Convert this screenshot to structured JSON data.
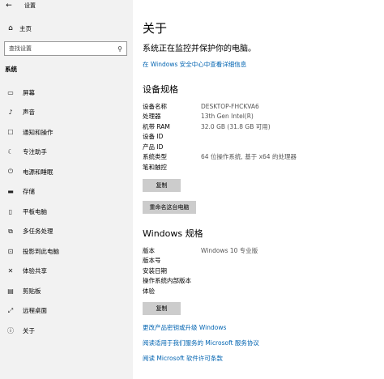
{
  "window": {
    "title": "设置",
    "back_glyph": "←"
  },
  "sidebar": {
    "home_label": "主页",
    "search_placeholder": "查找设置",
    "section": "系统",
    "items": [
      {
        "label": "屏幕",
        "icon": "monitor-icon"
      },
      {
        "label": "声音",
        "icon": "speaker-icon"
      },
      {
        "label": "通知和操作",
        "icon": "notification-icon"
      },
      {
        "label": "专注助手",
        "icon": "moon-icon"
      },
      {
        "label": "电源和睡眠",
        "icon": "power-icon"
      },
      {
        "label": "存储",
        "icon": "storage-icon"
      },
      {
        "label": "平板电脑",
        "icon": "tablet-icon"
      },
      {
        "label": "多任务处理",
        "icon": "multitask-icon"
      },
      {
        "label": "投影到此电脑",
        "icon": "project-icon"
      },
      {
        "label": "体验共享",
        "icon": "share-icon"
      },
      {
        "label": "剪贴板",
        "icon": "clipboard-icon"
      },
      {
        "label": "远程桌面",
        "icon": "remote-icon"
      },
      {
        "label": "关于",
        "icon": "info-icon"
      }
    ]
  },
  "main": {
    "title": "关于",
    "subtitle": "系统正在监控并保护你的电脑。",
    "security_link": "在 Windows 安全中心中查看详细信息",
    "device_specs": {
      "heading": "设备规格",
      "rows": [
        {
          "key": "设备名称",
          "value": "DESKTOP-FHCKVA6"
        },
        {
          "key": "处理器",
          "value": "13th Gen Intel(R)"
        },
        {
          "key": "机带 RAM",
          "value": "32.0 GB (31.8 GB 可用)"
        },
        {
          "key": "设备 ID",
          "value": ""
        },
        {
          "key": "产品 ID",
          "value": ""
        },
        {
          "key": "系统类型",
          "value": "64 位操作系统, 基于 x64 的处理器"
        },
        {
          "key": "笔和触控",
          "value": ""
        }
      ],
      "copy_button": "复制",
      "rename_button": "重命名这台电脑"
    },
    "windows_specs": {
      "heading": "Windows 规格",
      "rows": [
        {
          "key": "版本",
          "value": "Windows 10 专业版"
        },
        {
          "key": "版本号",
          "value": ""
        },
        {
          "key": "安装日期",
          "value": ""
        },
        {
          "key": "操作系统内部版本",
          "value": ""
        },
        {
          "key": "体验",
          "value": ""
        }
      ],
      "copy_button": "复制"
    },
    "links": [
      "更改产品密钥或升级 Windows",
      "阅读适用于我们服务的 Microsoft 服务协议",
      "阅读 Microsoft 软件许可条款"
    ]
  }
}
